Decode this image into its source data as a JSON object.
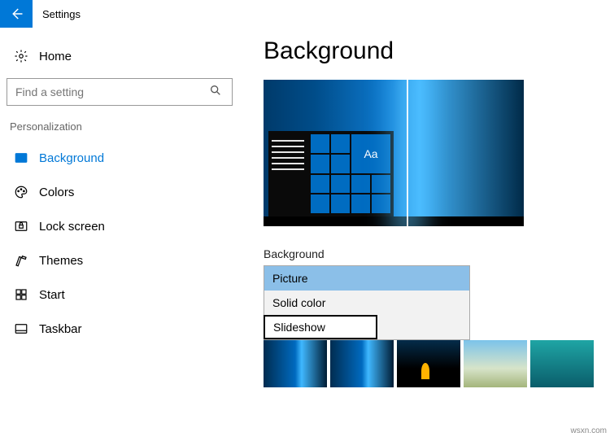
{
  "window": {
    "title": "Settings"
  },
  "sidebar": {
    "home": "Home",
    "search_placeholder": "Find a setting",
    "category": "Personalization",
    "items": [
      {
        "label": "Background"
      },
      {
        "label": "Colors"
      },
      {
        "label": "Lock screen"
      },
      {
        "label": "Themes"
      },
      {
        "label": "Start"
      },
      {
        "label": "Taskbar"
      }
    ]
  },
  "main": {
    "heading": "Background",
    "preview_sample_text": "Aa",
    "dropdown_label": "Background",
    "dropdown": {
      "options": [
        {
          "label": "Picture",
          "selected": true
        },
        {
          "label": "Solid color"
        },
        {
          "label": "Slideshow",
          "highlighted": true
        }
      ]
    }
  },
  "watermark": "wsxn.com"
}
